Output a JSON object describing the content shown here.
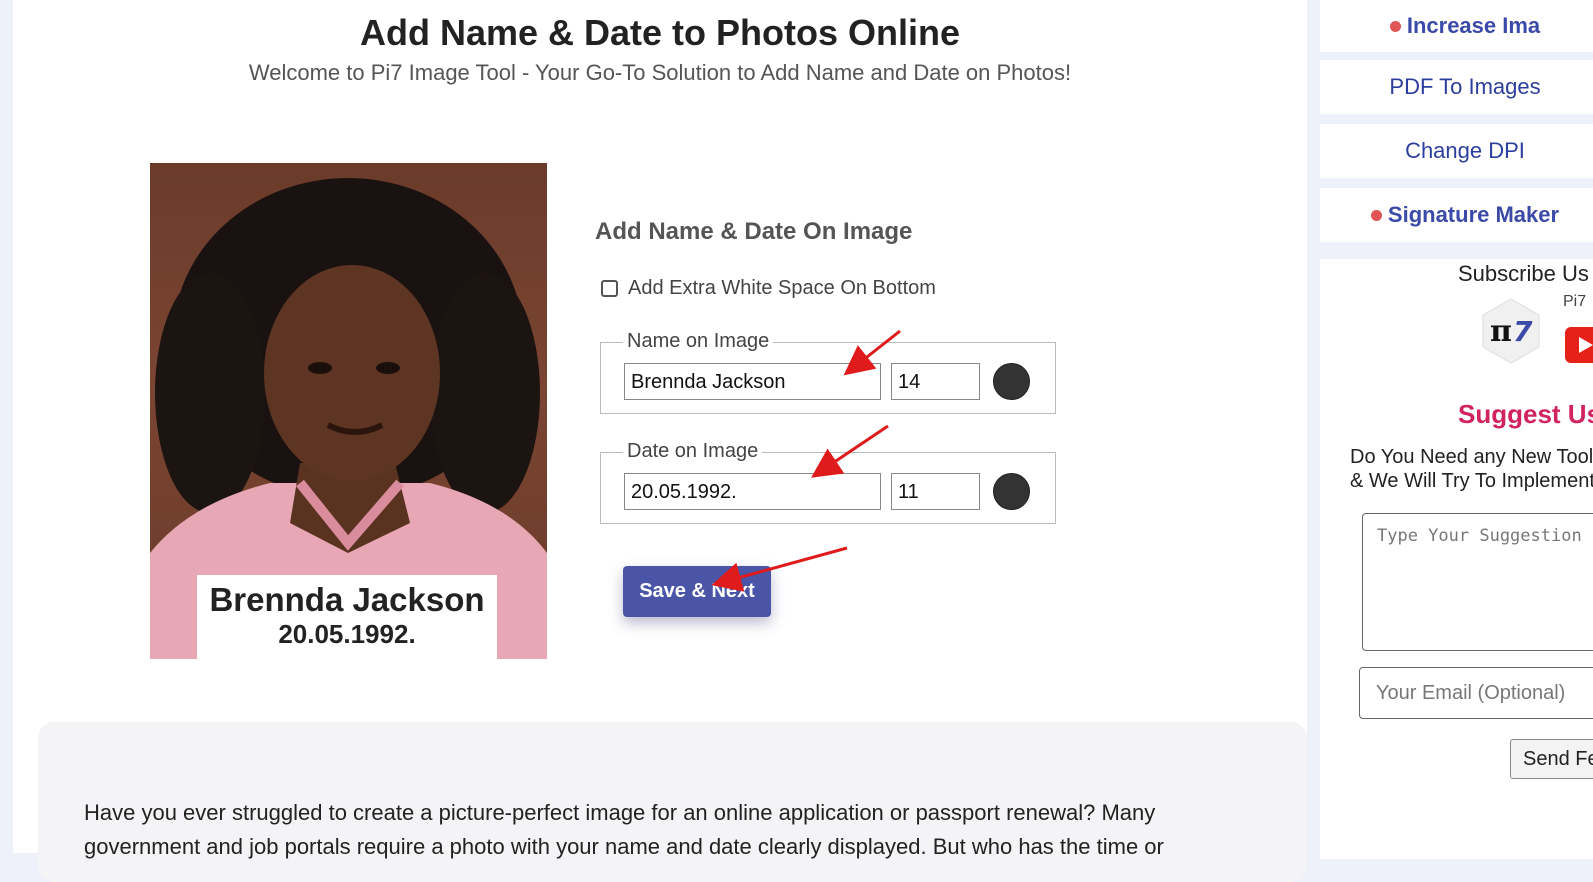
{
  "page": {
    "title": "Add Name & Date to Photos Online",
    "subtitle": "Welcome to Pi7 Image Tool - Your Go-To Solution to Add Name and Date on Photos!"
  },
  "preview": {
    "caption_name": "Brennda Jackson",
    "caption_date": "20.05.1992."
  },
  "form": {
    "heading": "Add Name & Date On Image",
    "extra_space_label": "Add Extra White Space On Bottom",
    "extra_space_checked": false,
    "name_legend": "Name on Image",
    "name_value": "Brennda Jackson",
    "name_size": "14",
    "name_color": "#333333",
    "date_legend": "Date on Image",
    "date_value": "20.05.1992.",
    "date_size": "11",
    "date_color": "#333333",
    "save_label": "Save & Next"
  },
  "article": {
    "text": "Have you ever struggled to create a picture-perfect image for an online application or passport renewal? Many government and job portals require a photo with your name and date clearly displayed. But who has the time or"
  },
  "sidebar": {
    "links": [
      {
        "label": "Increase Ima",
        "highlight": true
      },
      {
        "label": "PDF To Images",
        "highlight": false
      },
      {
        "label": "Change DPI",
        "highlight": false
      },
      {
        "label": "Signature Maker",
        "highlight": true
      }
    ],
    "subscribe_title": "Subscribe Us",
    "channel_label": "Pi7",
    "suggest_title": "Suggest Us",
    "suggest_desc": "Do You Need any New Tool? Tell Us & We Will Try To Implement",
    "suggest_placeholder": "Type Your Suggestion",
    "email_placeholder": "Your Email (Optional)",
    "send_label": "Send Feedback"
  },
  "colors": {
    "accent": "#4a55a8",
    "link": "#2c3e9e",
    "suggest": "#d1245e",
    "annotation_arrow": "#e01b1b"
  }
}
